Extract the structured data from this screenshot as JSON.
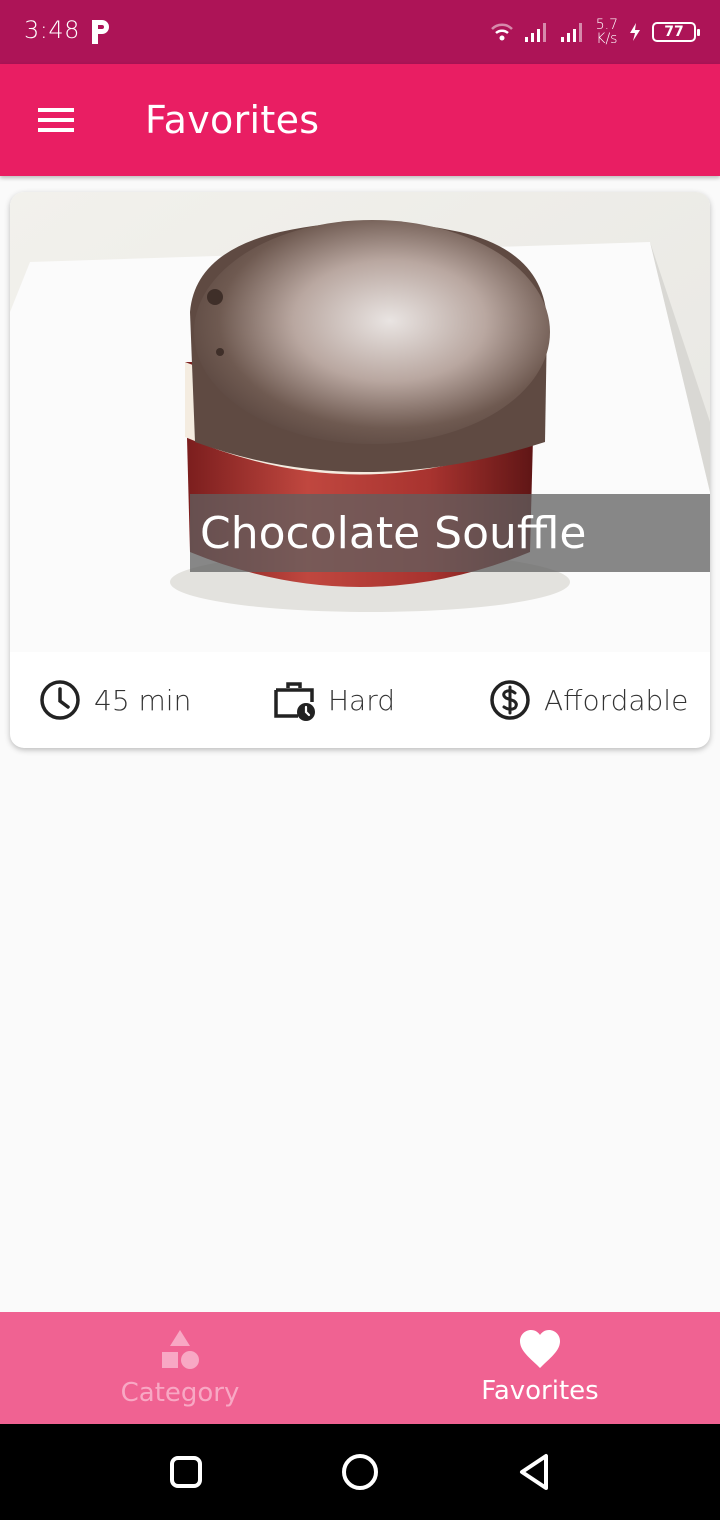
{
  "status_bar": {
    "time": "3:48",
    "net_speed_value": "5.7",
    "net_speed_unit": "K/s",
    "battery_level": "77",
    "background_color": "#ad1457"
  },
  "app_bar": {
    "title": "Favorites",
    "menu_icon": "menu-icon",
    "background_color": "#e91e63"
  },
  "favorites": [
    {
      "title": "Chocolate Souffle",
      "duration": "45 min",
      "complexity": "Hard",
      "affordability": "Affordable",
      "duration_icon": "clock-icon",
      "complexity_icon": "work-history-icon",
      "affordability_icon": "dollar-icon"
    }
  ],
  "bottom_nav": {
    "background_color": "#f06292",
    "tabs": [
      {
        "label": "Category",
        "icon": "category-icon",
        "active": false
      },
      {
        "label": "Favorites",
        "icon": "heart-icon",
        "active": true
      }
    ]
  },
  "system_nav": {
    "buttons": [
      "recents-icon",
      "home-icon",
      "back-icon"
    ]
  }
}
